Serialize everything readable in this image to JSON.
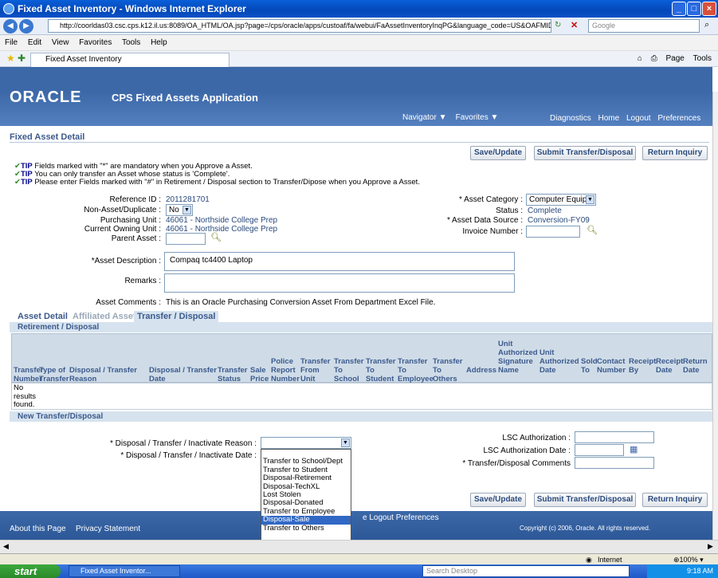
{
  "window": {
    "title": "Fixed Asset Inventory - Windows Internet Explorer"
  },
  "browser": {
    "url": "http://coorldas03.csc.cps.k12.il.us:8089/OA_HTML/OA.jsp?page=/cps/oracle/apps/custoaf/fa/webui/FaAssetInventoryInqPG&language_code=US&OAFMID=10237758searchTy",
    "search_placeholder": "Google",
    "menu": [
      "File",
      "Edit",
      "View",
      "Favorites",
      "Tools",
      "Help"
    ],
    "tab_label": "Fixed Asset Inventory",
    "tools": [
      "Page",
      "Tools"
    ]
  },
  "app": {
    "logo": "ORACLE",
    "name": "CPS Fixed Assets Application",
    "navigator": "Navigator",
    "favorites": "Favorites",
    "global_links": [
      "Diagnostics",
      "Home",
      "Logout",
      "Preferences"
    ]
  },
  "page": {
    "title": "Fixed Asset Detail",
    "buttons": {
      "save": "Save/Update",
      "submit": "Submit Transfer/Disposal",
      "return": "Return Inquiry"
    },
    "tips": [
      {
        "prefix": "TIP",
        "text": " Fields marked with \"*\" are mandatory when you Approve a Asset."
      },
      {
        "prefix": "TIP",
        "text": " You can only transfer an Asset whose status is 'Complete'."
      },
      {
        "prefix": "TIP",
        "text": " Please enter Fields marked with \"#\" in Retirement / Disposal section to Transfer/Dipose when you Approve a Asset."
      }
    ]
  },
  "form": {
    "reference_id_label": "Reference ID :",
    "reference_id": "2011281701",
    "non_asset_label": "Non-Asset/Duplicate :",
    "non_asset": "No",
    "purchasing_unit_label": "Purchasing Unit :",
    "purchasing_unit": "46061 - Northside College Prep",
    "owning_unit_label": "Current Owning Unit :",
    "owning_unit": "46061 - Northside College Prep",
    "parent_asset_label": "Parent Asset :",
    "asset_category_label": "* Asset Category :",
    "asset_category": "Computer Equip",
    "status_label": "Status :",
    "status": "Complete",
    "data_source_label": "* Asset Data Source :",
    "data_source": "Conversion-FY09",
    "invoice_label": "Invoice Number :",
    "description_label": "*Asset Description :",
    "description": "Compaq tc4400 Laptop",
    "remarks_label": "Remarks :",
    "comments_label": "Asset Comments :",
    "comments": "This is an Oracle Purchasing Conversion Asset From Department Excel File."
  },
  "tabs": [
    "Asset Detail",
    "Affiliated Asset",
    "Transfer / Disposal"
  ],
  "retirement": {
    "header": "Retirement / Disposal",
    "columns": [
      "Transfer Number",
      "Type of Transfer",
      "Disposal / Transfer Reason",
      "Disposal / Transfer Date",
      "Transfer Status",
      "Sale Price",
      "Police Report Number",
      "Transfer From Unit",
      "Transfer To School",
      "Transfer To Student",
      "Transfer To Employee",
      "Transfer To Others",
      "Address",
      "Unit Authorized Signature Name",
      "Unit Authorized Date",
      "Sold To",
      "Contact Number",
      "Receipt By",
      "Receipt Date",
      "Return Date"
    ],
    "empty": "No results found."
  },
  "new_transfer": {
    "header": "New Transfer/Disposal",
    "reason_label": "* Disposal / Transfer / Inactivate Reason :",
    "date_label": "* Disposal / Transfer / Inactivate Date :",
    "lsc_auth_label": "LSC Authorization :",
    "lsc_date_label": "LSC Authorization Date :",
    "comments_label": "* Transfer/Disposal Comments",
    "dropdown_options": [
      "",
      "Transfer to School/Dept",
      "Transfer to Student",
      "Disposal-Retirement",
      "Disposal-TechXL",
      "Lost Stolen",
      "Disposal-Donated",
      "Transfer to Employee",
      "Disposal-Sale",
      "Transfer to Others"
    ],
    "highlighted": "Disposal-Sale"
  },
  "footer": {
    "links": [
      "About this Page",
      "Privacy Statement"
    ],
    "center_links": "e  Logout  Preferences",
    "copyright": "Copyright (c) 2006, Oracle. All rights reserved."
  },
  "statusbar": {
    "zone": "Internet",
    "zoom": "100%"
  },
  "taskbar": {
    "start": "start",
    "task": "Fixed Asset Inventor...",
    "search": "Search Desktop",
    "time": "9:18 AM"
  },
  "colors": {
    "banner": "#3c68a8",
    "section": "#d6e3ef",
    "header_text": "#3c5a8c",
    "highlight": "#3168c5"
  }
}
